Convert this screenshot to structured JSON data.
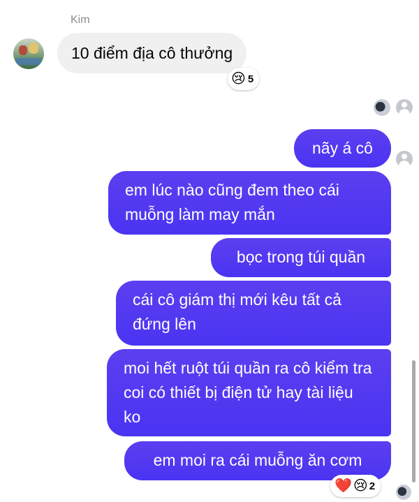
{
  "conversation": {
    "sender_name": "Kim",
    "incoming": {
      "text": "10 điểm địa cô thưởng",
      "reaction": {
        "emoji": "😢",
        "count": "5"
      }
    },
    "outgoing": [
      {
        "text": "nãy á cô"
      },
      {
        "text": "em lúc nào cũng đem theo cái muỗng làm may mắn"
      },
      {
        "text": "bọc trong túi quần"
      },
      {
        "text": "cái cô giám thị mới kêu tất cả đứng lên"
      },
      {
        "text": "moi hết ruột túi quần ra cô kiểm tra coi có thiết bị điện tử hay tài liệu ko"
      },
      {
        "text": "em moi ra cái muỗng ăn cơm"
      }
    ],
    "last_reactions": {
      "heart": "❤️",
      "cry": "😢",
      "count": "2"
    }
  },
  "icons": {
    "avatar_kim": "kim-avatar-photo",
    "seen_avatar_1": "seen-avatar-photo",
    "seen_avatar_2": "seen-avatar-default"
  },
  "colors": {
    "outgoing_bubble": "#4a34f2",
    "incoming_bubble": "#f0f0f0",
    "sender_name": "#8a8d91"
  }
}
